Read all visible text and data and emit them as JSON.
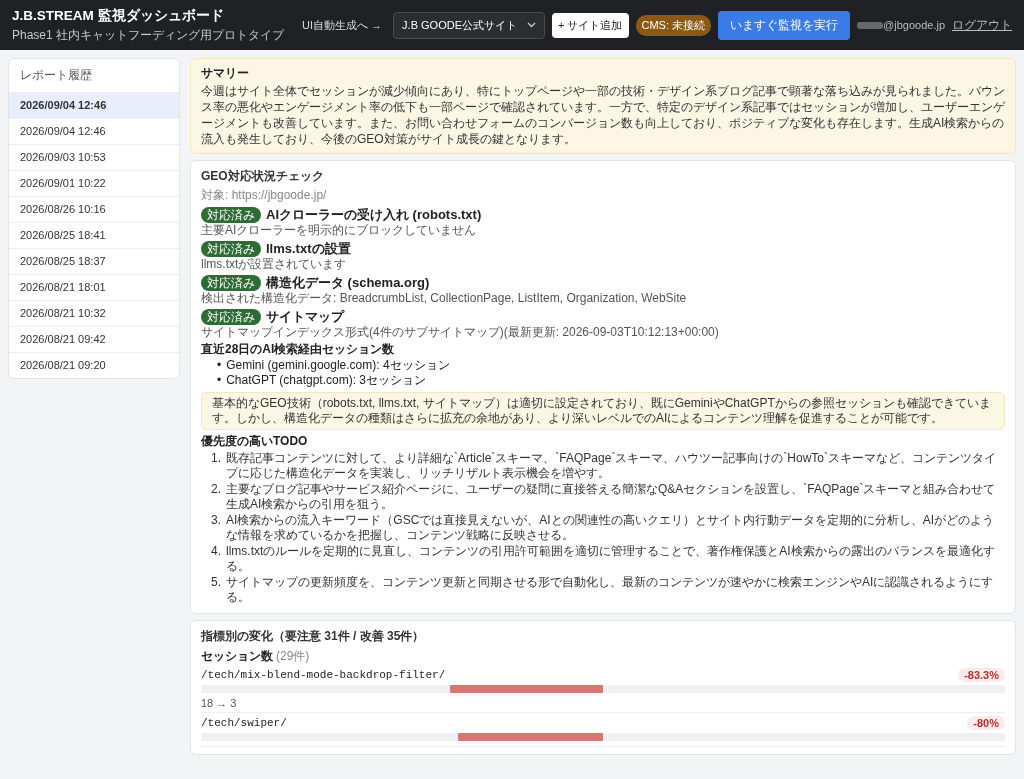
{
  "header": {
    "title": "J.B.STREAM 監視ダッシュボード",
    "subtitle": "Phase1 社内キャットフーディング用プロトタイプ",
    "ui_link": "UI自動生成へ →",
    "site_select": "J.B GOODE公式サイト",
    "add_site": "+ サイト追加",
    "cms_status": "CMS: 未接続",
    "run_button": "いますぐ監視を実行",
    "user_email": "@jbgoode.jp",
    "logout": "ログアウト"
  },
  "sidebar": {
    "title": "レポート履歴",
    "items": [
      {
        "label": "2026/09/04 12:46",
        "selected": true
      },
      {
        "label": "2026/09/04 12:46",
        "selected": false
      },
      {
        "label": "2026/09/03 10:53",
        "selected": false
      },
      {
        "label": "2026/09/01 10:22",
        "selected": false
      },
      {
        "label": "2026/08/26 10:16",
        "selected": false
      },
      {
        "label": "2026/08/25 18:41",
        "selected": false
      },
      {
        "label": "2026/08/25 18:37",
        "selected": false
      },
      {
        "label": "2026/08/21 18:01",
        "selected": false
      },
      {
        "label": "2026/08/21 10:32",
        "selected": false
      },
      {
        "label": "2026/08/21 09:42",
        "selected": false
      },
      {
        "label": "2026/08/21 09:20",
        "selected": false
      }
    ]
  },
  "summary": {
    "title": "サマリー",
    "text": "今週はサイト全体でセッションが減少傾向にあり、特にトップページや一部の技術・デザイン系ブログ記事で顕著な落ち込みが見られました。バウンス率の悪化やエンゲージメント率の低下も一部ページで確認されています。一方で、特定のデザイン系記事ではセッションが増加し、ユーザーエンゲージメントも改善しています。また、お問い合わせフォームのコンバージョン数も向上しており、ポジティブな変化も存在します。生成AI検索からの流入も発生しており、今後のGEO対策がサイト成長の鍵となります。"
  },
  "geo": {
    "title": "GEO対応状況チェック",
    "target": "対象: https://jbgoode.jp/",
    "checks": [
      {
        "badge": "対応済み",
        "title": "AIクローラーの受け入れ (robots.txt)",
        "detail": "主要AIクローラーを明示的にブロックしていません"
      },
      {
        "badge": "対応済み",
        "title": "llms.txtの設置",
        "detail": "llms.txtが設置されています"
      },
      {
        "badge": "対応済み",
        "title": "構造化データ (schema.org)",
        "detail": "検出された構造化データ: BreadcrumbList, CollectionPage, ListItem, Organization, WebSite"
      },
      {
        "badge": "対応済み",
        "title": "サイトマップ",
        "detail": "サイトマップインデックス形式(4件のサブサイトマップ)(最新更新: 2026-09-03T10:12:13+00:00)"
      }
    ],
    "sessions_title": "直近28日のAI検索経由セッション数",
    "sessions": [
      {
        "marker": "•",
        "text": "Gemini (gemini.google.com): 4セッション"
      },
      {
        "marker": "•",
        "text": "ChatGPT (chatgpt.com): 3セッション"
      }
    ],
    "note": "基本的なGEO技術（robots.txt, llms.txt, サイトマップ）は適切に設定されており、既にGeminiやChatGPTからの参照セッションも確認できています。しかし、構造化データの種類はさらに拡充の余地があり、より深いレベルでのAIによるコンテンツ理解を促進することが可能です。",
    "todo_title": "優先度の高いTODO",
    "todos": [
      {
        "number": "1.",
        "text": "既存記事コンテンツに対して、より詳細な`Article`スキーマ、`FAQPage`スキーマ、ハウツー記事向けの`HowTo`スキーマなど、コンテンツタイプに応じた構造化データを実装し、リッチリザルト表示機会を増やす。"
      },
      {
        "number": "2.",
        "text": "主要なブログ記事やサービス紹介ページに、ユーザーの疑問に直接答える簡潔なQ&Aセクションを設置し、`FAQPage`スキーマと組み合わせて生成AI検索からの引用を狙う。"
      },
      {
        "number": "3.",
        "text": "AI検索からの流入キーワード（GSCでは直接見えないが、AIとの関連性の高いクエリ）とサイト内行動データを定期的に分析し、AIがどのような情報を求めているかを把握し、コンテンツ戦略に反映させる。"
      },
      {
        "number": "4.",
        "text": "llms.txtのルールを定期的に見直し、コンテンツの引用許可範囲を適切に管理することで、著作権保護とAI検索からの露出のバランスを最適化する。"
      },
      {
        "number": "5.",
        "text": "サイトマップの更新頻度を、コンテンツ更新と同期させる形で自動化し、最新のコンテンツが速やかに検索エンジンやAIに認識されるようにする。"
      }
    ]
  },
  "metrics": {
    "title": "指標別の変化（要注意 31件 / 改善 35件）",
    "section_title": "セッション数",
    "section_count": "(29件)",
    "rows": [
      {
        "path": "/tech/mix-blend-mode-backdrop-filter/",
        "change": "-83.3%",
        "level": 0.38,
        "values": "18 → 3"
      },
      {
        "path": "/tech/swiper/",
        "change": "-80%",
        "level": 0.36
      }
    ]
  }
}
